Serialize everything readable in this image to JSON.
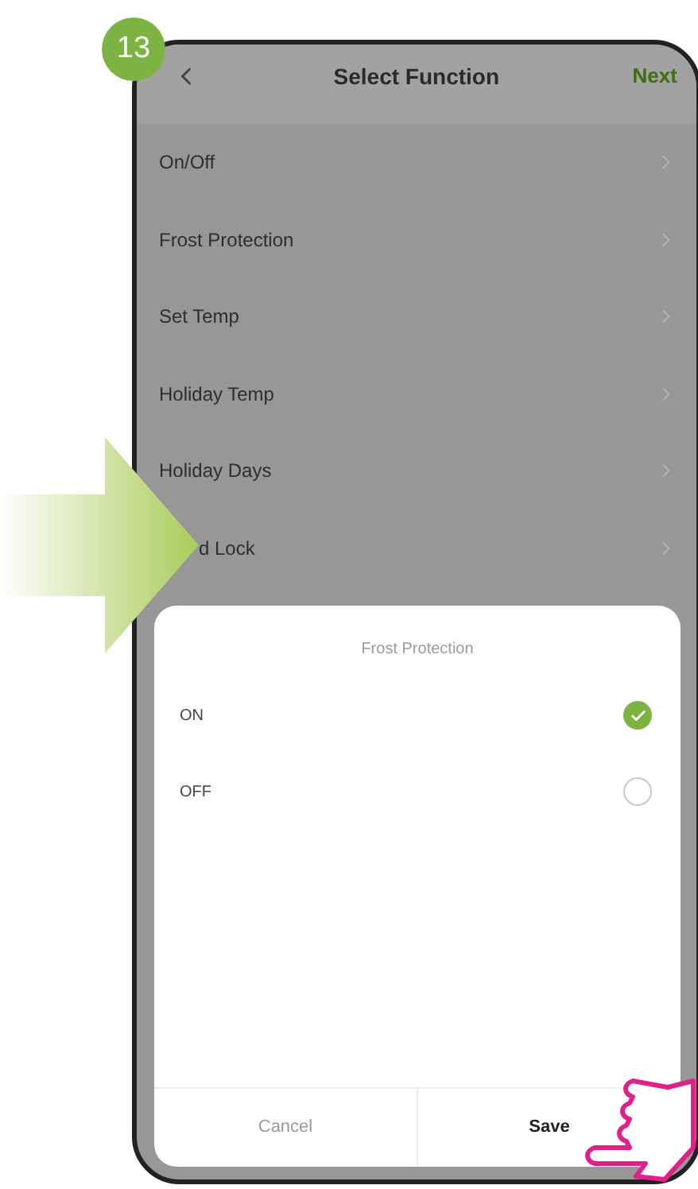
{
  "step_badge": "13",
  "header": {
    "title": "Select Function",
    "action": "Next"
  },
  "functions": [
    {
      "label": "On/Off",
      "kind": "row"
    },
    {
      "label": "Frost Protection",
      "kind": "row"
    },
    {
      "label": "Set Temp",
      "kind": "row"
    },
    {
      "label": "Holiday Temp",
      "kind": "row"
    },
    {
      "label": "Holiday Days",
      "kind": "row"
    },
    {
      "label": "d Lock",
      "kind": "covered"
    }
  ],
  "dialog": {
    "title": "Frost Protection",
    "options": [
      {
        "label": "ON",
        "selected": true
      },
      {
        "label": "OFF",
        "selected": false
      }
    ],
    "buttons": [
      {
        "label": "Cancel",
        "kind": "cancel"
      },
      {
        "label": "Save",
        "kind": "primary"
      }
    ]
  }
}
